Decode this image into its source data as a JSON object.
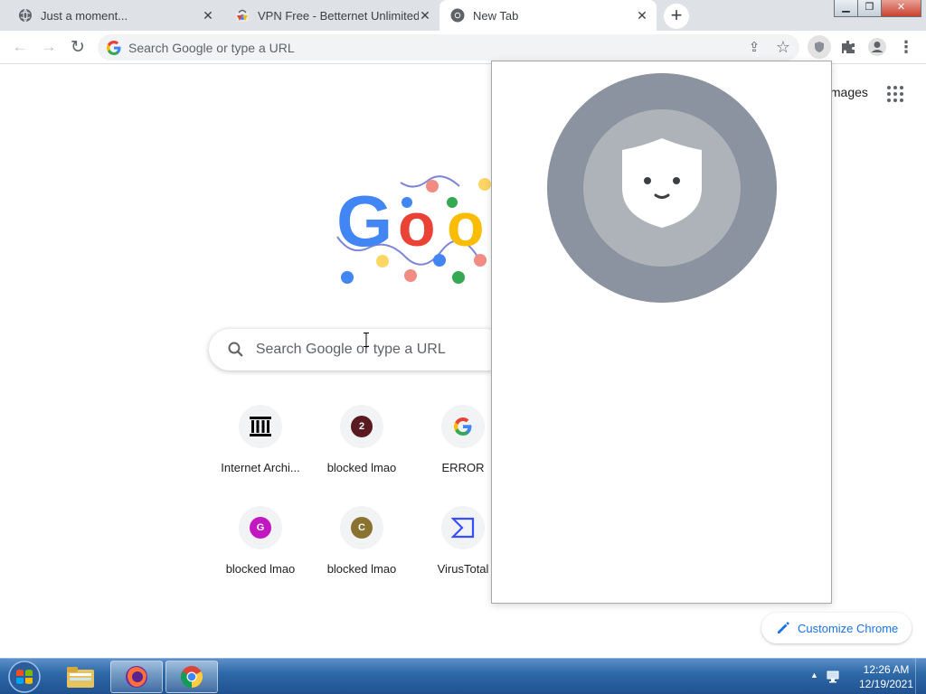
{
  "tabs": [
    {
      "title": "Just a moment...",
      "icon": "globe-icon",
      "close": "✕"
    },
    {
      "title": "VPN Free - Betternet Unlimited VPN",
      "icon": "chrome-web-store-icon",
      "close": "✕"
    },
    {
      "title": "New Tab",
      "icon": "chrome-icon",
      "close": "✕"
    }
  ],
  "new_tab_symbol": "+",
  "window_controls": {
    "minimize": "▁",
    "maximize": "❐",
    "close": "✕"
  },
  "toolbar": {
    "back": "←",
    "forward": "→",
    "reload": "↻",
    "omnibox_placeholder": "Search Google or type a URL",
    "share": "⇪",
    "bookmark": "☆",
    "more": "⋮"
  },
  "ntp": {
    "images_link": "Images",
    "search_placeholder": "Search Google or type a URL",
    "shortcuts": [
      {
        "label": "Internet Archi...",
        "badge": "🏛",
        "badge_color": "#ffffff"
      },
      {
        "label": "blocked lmao",
        "badge": "2",
        "badge_color": "#5a1a22"
      },
      {
        "label": "ERROR",
        "badge": "G",
        "badge_color": "#ffffff"
      },
      {
        "label": "blocked lmao",
        "badge": "G",
        "badge_color": "#c218c2"
      },
      {
        "label": "blocked lmao",
        "badge": "C",
        "badge_color": "#8a7230"
      },
      {
        "label": "VirusTotal",
        "badge": "Σ",
        "badge_color": "#ffffff"
      }
    ],
    "customize_label": "Customize Chrome"
  },
  "taskbar": {
    "time": "12:26 AM",
    "date": "12/19/2021"
  },
  "colors": {
    "accent": "#1a73e8",
    "taskbar": "#2f6aa8",
    "popup_outer": "#8a939f",
    "popup_inner": "#aeb3b9"
  }
}
